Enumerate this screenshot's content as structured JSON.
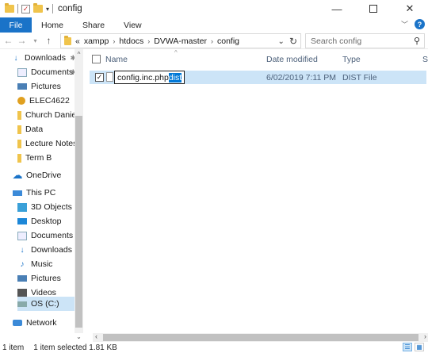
{
  "window": {
    "title": "config"
  },
  "controls": {
    "minimize": "—",
    "close": "✕"
  },
  "ribbon": {
    "tabs": [
      "File",
      "Home",
      "Share",
      "View"
    ]
  },
  "address": {
    "crumbs": [
      "xampp",
      "htdocs",
      "DVWA-master",
      "config"
    ],
    "overflow": "«",
    "search_placeholder": "Search config"
  },
  "nav": {
    "items": [
      {
        "label": "Downloads",
        "icon": "download-icon",
        "pinned": true
      },
      {
        "label": "Documents",
        "icon": "documents-icon",
        "pinned": true
      },
      {
        "label": "Pictures",
        "icon": "pictures-icon",
        "pinned": true
      },
      {
        "label": "ELEC4622",
        "icon": "chrome-icon",
        "pinned": true
      },
      {
        "label": "Church Daniel",
        "icon": "folder-icon",
        "pinned": false
      },
      {
        "label": "Data",
        "icon": "folder-icon",
        "pinned": false
      },
      {
        "label": "Lecture Notes",
        "icon": "folder-icon",
        "pinned": false
      },
      {
        "label": "Term B",
        "icon": "folder-icon",
        "pinned": false
      },
      {
        "label": "OneDrive",
        "icon": "onedrive-icon",
        "pinned": false
      },
      {
        "label": "This PC",
        "icon": "thispc-icon",
        "pinned": false
      },
      {
        "label": "3D Objects",
        "icon": "3d-objects-icon",
        "pinned": false
      },
      {
        "label": "Desktop",
        "icon": "desktop-icon",
        "pinned": false
      },
      {
        "label": "Documents",
        "icon": "documents-icon",
        "pinned": false
      },
      {
        "label": "Downloads",
        "icon": "download-icon",
        "pinned": false
      },
      {
        "label": "Music",
        "icon": "music-icon",
        "pinned": false
      },
      {
        "label": "Pictures",
        "icon": "pictures-icon",
        "pinned": false
      },
      {
        "label": "Videos",
        "icon": "videos-icon",
        "pinned": false
      },
      {
        "label": "OS (C:)",
        "icon": "drive-icon",
        "pinned": false,
        "selected": true
      },
      {
        "label": "Network",
        "icon": "network-icon",
        "pinned": false
      }
    ]
  },
  "columns": [
    "Name",
    "Date modified",
    "Type",
    "Si"
  ],
  "files": [
    {
      "name_base": "config.inc.php",
      "name_ext": "dist",
      "date": "6/02/2019 7:11 PM",
      "type": "DIST File",
      "checked": true
    }
  ],
  "status": {
    "items": "1 item",
    "selected": "1 item selected  1.81 KB"
  },
  "colors": {
    "accent": "#1a73c8",
    "selection": "#cce4f7",
    "highlight": "#0078d7"
  }
}
